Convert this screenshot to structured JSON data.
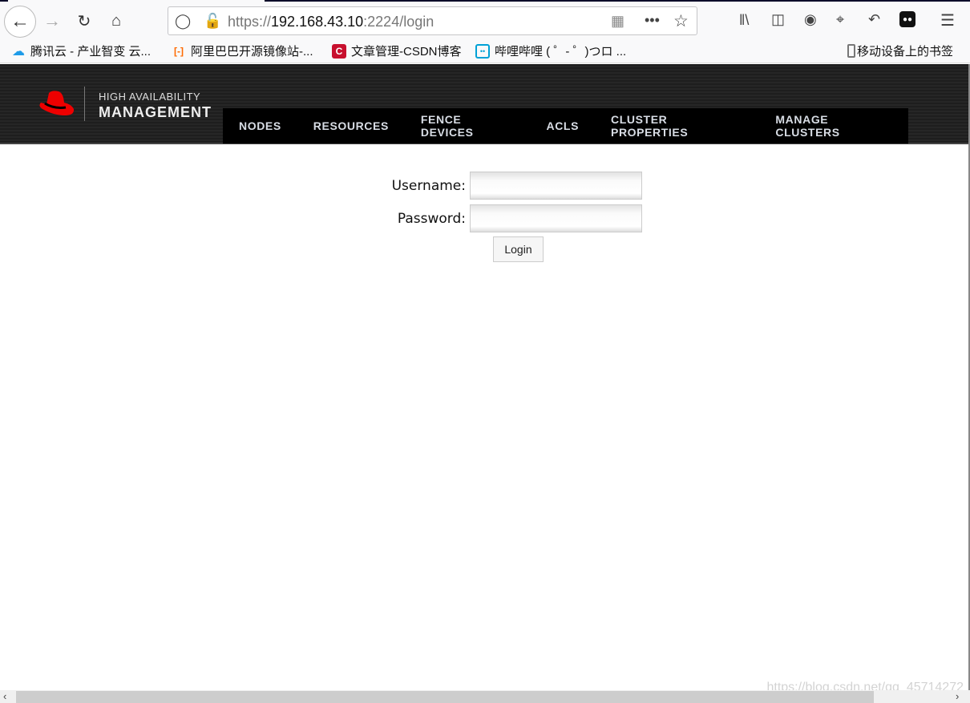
{
  "browser": {
    "url_scheme": "https://",
    "url_host": "192.168.43.10",
    "url_rest": ":2224/login",
    "bookmarks": [
      {
        "label": "腾讯云 - 产业智变 云...",
        "icon": "cloud-icon"
      },
      {
        "label": "阿里巴巴开源镜像站-...",
        "icon": "aliyun-icon"
      },
      {
        "label": "文章管理-CSDN博客",
        "icon": "csdn-icon"
      },
      {
        "label": "哔哩哔哩 ( ゜- ゜)つロ ...",
        "icon": "bilibili-icon"
      }
    ],
    "mobile_bookmarks": "移动设备上的书签"
  },
  "app": {
    "logo_line1": "HIGH AVAILABILITY",
    "logo_line2": "MANAGEMENT",
    "nav": [
      "NODES",
      "RESOURCES",
      "FENCE DEVICES",
      "ACLS",
      "CLUSTER PROPERTIES",
      "MANAGE CLUSTERS"
    ],
    "brand_color": "#ee0000"
  },
  "login": {
    "username_label": "Username:",
    "password_label": "Password:",
    "username_value": "",
    "password_value": "",
    "button": "Login"
  },
  "watermark": "https://blog.csdn.net/qq_45714272"
}
